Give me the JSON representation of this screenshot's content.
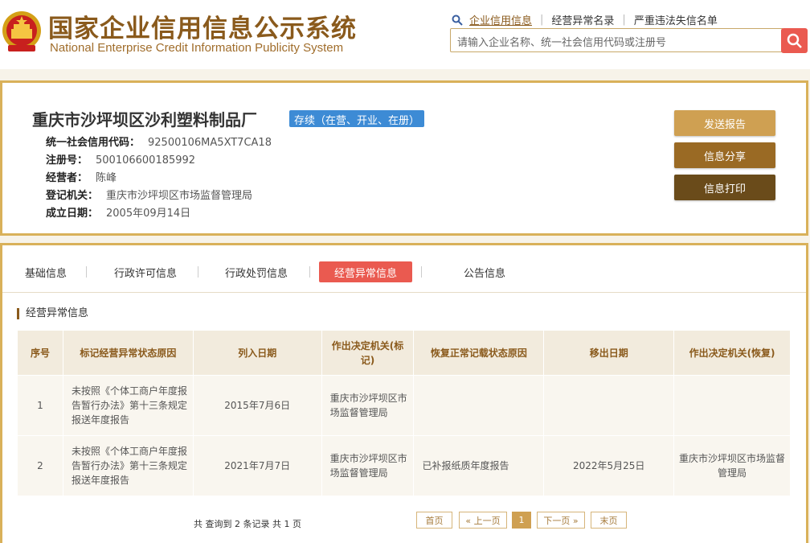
{
  "header": {
    "title_cn": "国家企业信用信息公示系统",
    "title_en": "National Enterprise Credit Information Publicity System",
    "links": [
      "企业信用信息",
      "经营异常名录",
      "严重违法失信名单"
    ],
    "search_placeholder": "请输入企业名称、统一社会信用代码或注册号"
  },
  "company": {
    "name": "重庆市沙坪坝区沙利塑料制品厂",
    "status": "存续（在营、开业、在册）",
    "fields": [
      {
        "label": "统一社会信用代码：",
        "value": "92500106MA5XT7CA18"
      },
      {
        "label": "注册号：",
        "value": "500106600185992"
      },
      {
        "label": "经营者：",
        "value": "陈峰"
      },
      {
        "label": "登记机关：",
        "value": "重庆市沙坪坝区市场监督管理局"
      },
      {
        "label": "成立日期：",
        "value": "2005年09月14日"
      }
    ],
    "buttons": [
      "发送报告",
      "信息分享",
      "信息打印"
    ]
  },
  "tabs": [
    "基础信息",
    "行政许可信息",
    "行政处罚信息",
    "经营异常信息",
    "公告信息"
  ],
  "active_tab": "经营异常信息",
  "section_title": "经营异常信息",
  "table": {
    "headers": [
      "序号",
      "标记经营异常状态原因",
      "列入日期",
      "作出决定机关(标记)",
      "恢复正常记载状态原因",
      "移出日期",
      "作出决定机关(恢复)"
    ],
    "rows": [
      [
        "1",
        "未按照《个体工商户年度报告暂行办法》第十三条规定报送年度报告",
        "2015年7月6日",
        "重庆市沙坪坝区市场监督管理局",
        "",
        "",
        ""
      ],
      [
        "2",
        "未按照《个体工商户年度报告暂行办法》第十三条规定报送年度报告",
        "2021年7月7日",
        "重庆市沙坪坝区市场监督管理局",
        "已补报纸质年度报告",
        "2022年5月25日",
        "重庆市沙坪坝区市场监督管理局"
      ]
    ]
  },
  "pagination": {
    "summary": "共 查询到 2 条记录 共 1 页",
    "first": "首页",
    "prev": "« 上一页",
    "current": "1",
    "next": "下一页 »",
    "last": "末页"
  },
  "colors": {
    "brand": "#8a5a1c",
    "border": "#d9b15a",
    "accent_red": "#ea5a50",
    "status_blue": "#3d8bd5"
  }
}
